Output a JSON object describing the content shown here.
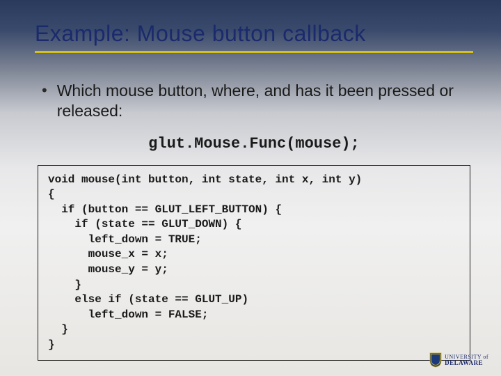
{
  "title": "Example: Mouse button callback",
  "bullet": "Which mouse button, where, and has it been pressed or released:",
  "api_call": "glut.Mouse.Func(mouse);",
  "code": "void mouse(int button, int state, int x, int y)\n{\n  if (button == GLUT_LEFT_BUTTON) {\n    if (state == GLUT_DOWN) {\n      left_down = TRUE;\n      mouse_x = x;\n      mouse_y = y;\n    }\n    else if (state == GLUT_UP)\n      left_down = FALSE;\n  }\n}",
  "logo": {
    "line1": "UNIVERSITY of",
    "line2": "DELAWARE"
  }
}
